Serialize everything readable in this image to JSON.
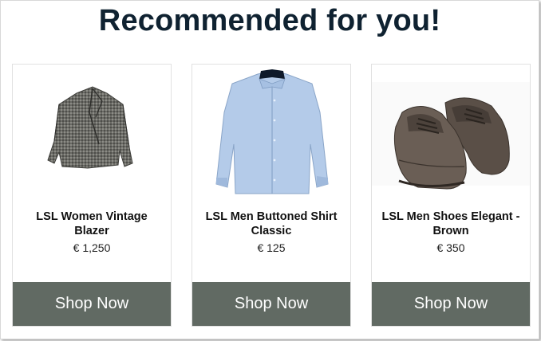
{
  "title": "Recommended for you!",
  "products": [
    {
      "name": "LSL Women Vintage Blazer",
      "price": "€ 1,250",
      "button": "Shop Now",
      "icon": "blazer-image"
    },
    {
      "name": "LSL Men Buttoned Shirt Classic",
      "price": "€ 125",
      "button": "Shop Now",
      "icon": "shirt-image"
    },
    {
      "name": "LSL Men Shoes Elegant - Brown",
      "price": "€ 350",
      "button": "Shop Now",
      "icon": "shoes-image"
    }
  ],
  "colors": {
    "button_bg": "#616a63",
    "title": "#0f2231"
  }
}
